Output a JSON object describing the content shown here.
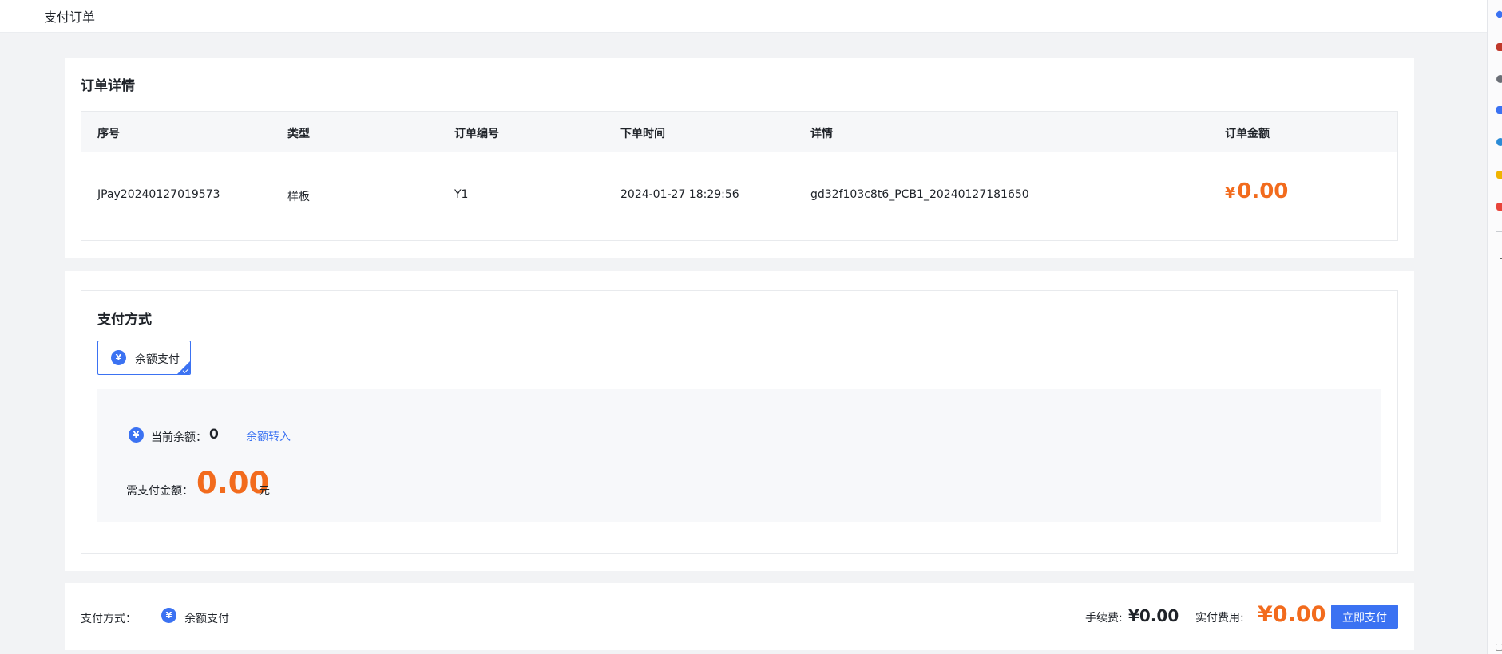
{
  "header": {
    "title": "支付订单"
  },
  "order_details": {
    "title": "订单详情",
    "columns": [
      "序号",
      "类型",
      "订单编号",
      "下单时间",
      "详情",
      "订单金额"
    ],
    "row": {
      "serial": "JPay20240127019573",
      "type": "样板",
      "order_no": "Y1",
      "order_time": "2024-01-27 18:29:56",
      "detail": "gd32f103c8t6_PCB1_20240127181650",
      "currency_symbol": "¥",
      "amount": "0.00"
    }
  },
  "payment_method": {
    "title": "支付方式",
    "option_label": "余额支付",
    "coin_glyph": "¥",
    "balance_label": "当前余额：",
    "balance_value": "0",
    "transfer_link": "余额转入",
    "need_pay_label": "需支付金额：",
    "need_pay_value": "0.00",
    "need_pay_unit": "元"
  },
  "footer": {
    "method_label": "支付方式：",
    "method_value": "余额支付",
    "fee_label": "手续费:",
    "fee_value": "¥0.00",
    "actual_label": "实付费用:",
    "actual_value": "¥0.00",
    "pay_button": "立即支付"
  },
  "colors": {
    "accent": "#3b72f2",
    "amount": "#f26b1d",
    "page_bg": "#f2f3f5"
  },
  "extension_icons": [
    "diamond-icon",
    "basket-icon",
    "person-icon",
    "cube-icon",
    "gear-icon",
    "triangle-icon",
    "puzzle-icon"
  ]
}
